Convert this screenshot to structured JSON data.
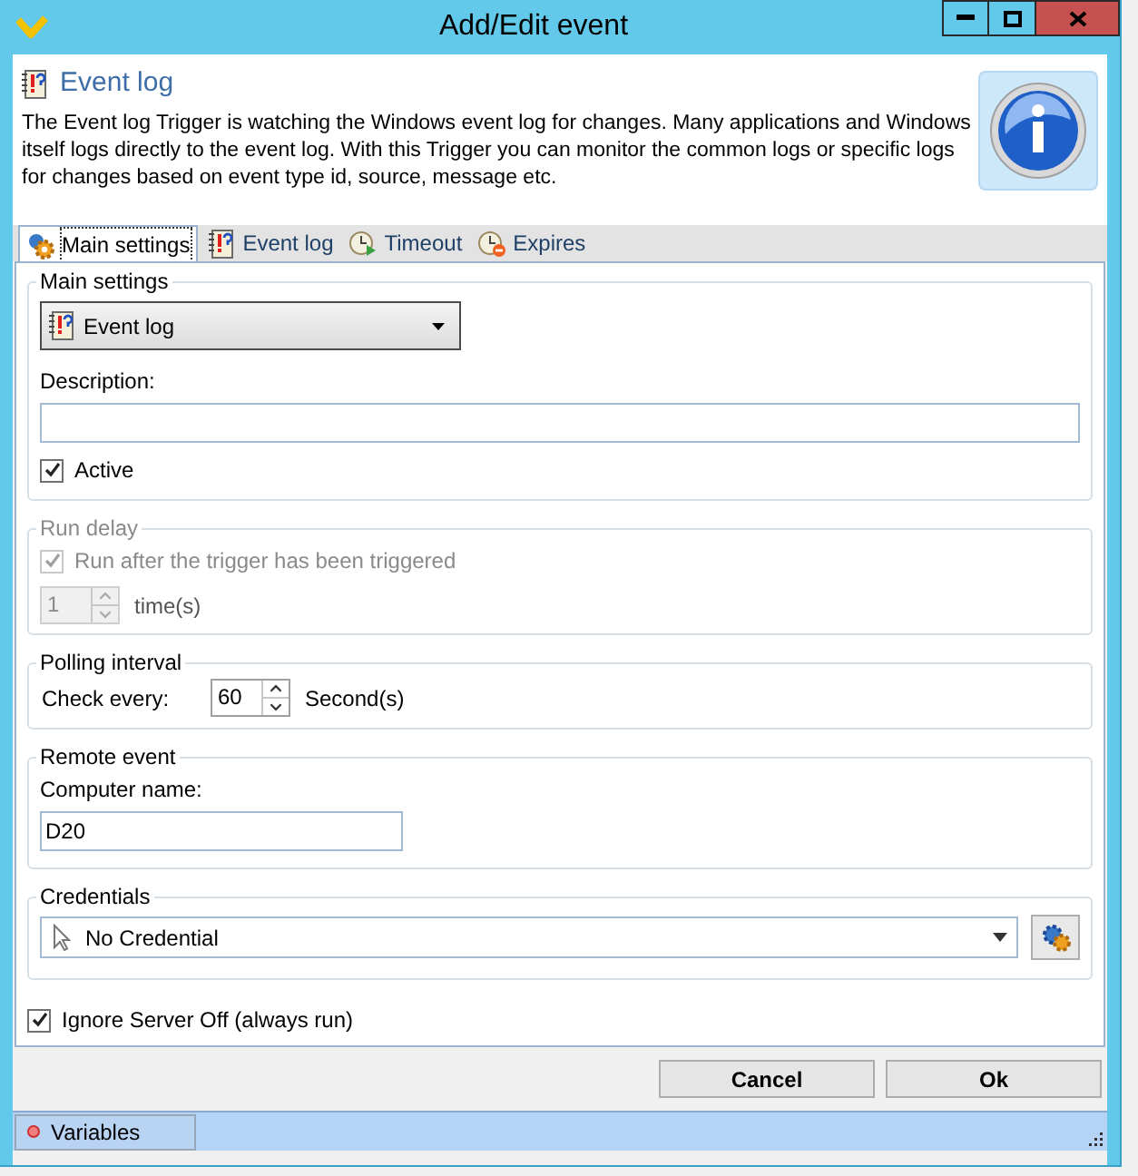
{
  "window": {
    "title": "Add/Edit event"
  },
  "header": {
    "title": "Event log",
    "description": "The Event log Trigger is watching the Windows event log for changes. Many applications and Windows itself logs directly to the event log. With this Trigger you can monitor the common logs or specific logs for changes based on event type id, source, message etc."
  },
  "tabs": [
    {
      "label": "Main settings",
      "selected": true
    },
    {
      "label": "Event log",
      "selected": false
    },
    {
      "label": "Timeout",
      "selected": false
    },
    {
      "label": "Expires",
      "selected": false
    }
  ],
  "main_settings": {
    "legend": "Main settings",
    "trigger_type": "Event log",
    "description_label": "Description:",
    "active": {
      "label": "Active",
      "checked": true
    }
  },
  "run_delay": {
    "legend": "Run delay",
    "disabled": true,
    "run_after": {
      "label": "Run after the trigger has been triggered",
      "checked": true
    },
    "times": {
      "value": "1",
      "unit": "time(s)"
    }
  },
  "polling_interval": {
    "legend": "Polling interval",
    "label": "Check every:",
    "value": "60",
    "unit": "Second(s)"
  },
  "remote_event": {
    "legend": "Remote event",
    "label": "Computer name:",
    "value": "D20"
  },
  "credentials": {
    "legend": "Credentials",
    "value": "No Credential"
  },
  "ignore_server_off": {
    "label": "Ignore Server Off (always run)",
    "checked": true
  },
  "buttons": [
    "Cancel",
    "Ok"
  ],
  "status_bar": {
    "tab": "Variables"
  }
}
